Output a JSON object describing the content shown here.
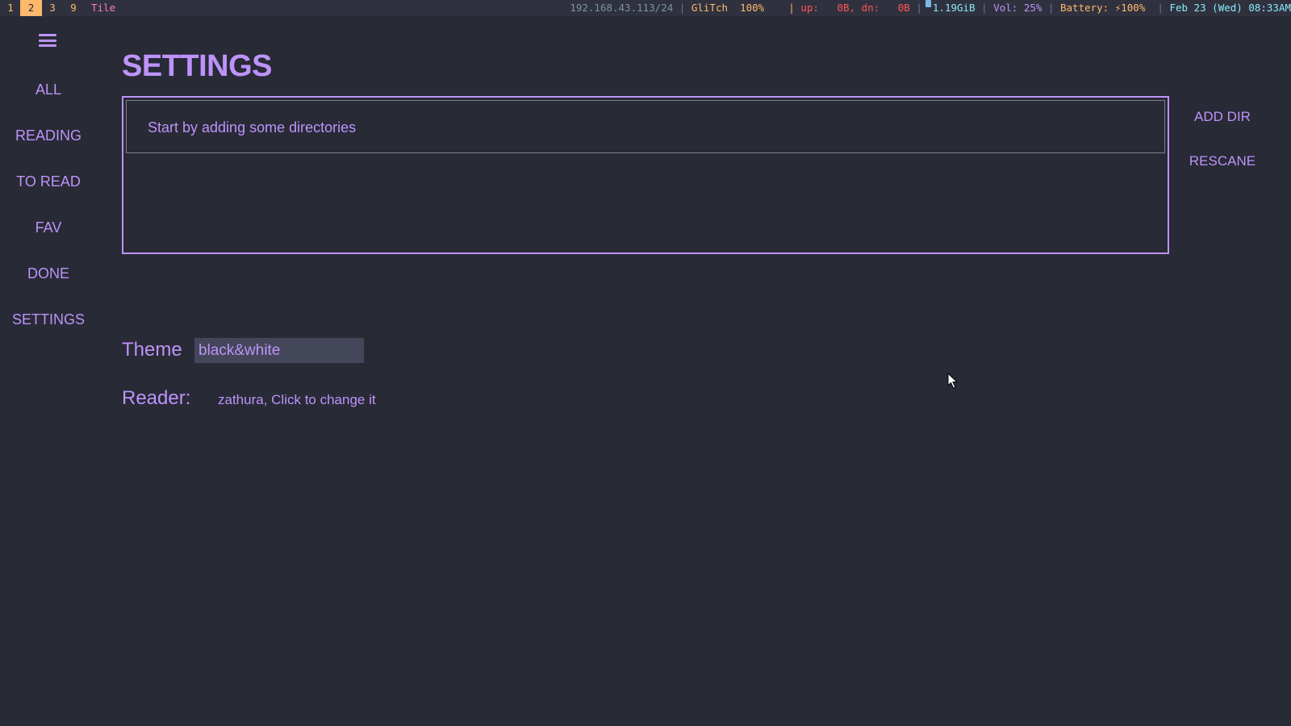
{
  "statusbar": {
    "workspaces": [
      {
        "label": "1",
        "active": false
      },
      {
        "label": "2",
        "active": true
      },
      {
        "label": "3",
        "active": false
      },
      {
        "label": "9",
        "active": false
      }
    ],
    "layout": "Tile",
    "network": "192.168.43.113/24",
    "wifi_name": "GliTch",
    "wifi_signal": "100%",
    "up_label": "up:",
    "up_value": "0B,",
    "down_label": "dn:",
    "down_value": "0B",
    "memory": "1.19GiB",
    "volume": "Vol: 25%",
    "battery": "Battery: ⚡100%",
    "datetime": "Feb 23 (Wed) 08:33AM",
    "separator": "|"
  },
  "sidebar": {
    "menu_icon": "hamburger-icon",
    "items": [
      {
        "label": "ALL"
      },
      {
        "label": "READING"
      },
      {
        "label": "TO READ"
      },
      {
        "label": "FAV"
      },
      {
        "label": "DONE"
      },
      {
        "label": "SETTINGS"
      }
    ]
  },
  "main": {
    "title": "SETTINGS",
    "directories": {
      "empty_text": "Start by adding some directories"
    },
    "add_dir_label": "ADD DIR",
    "rescan_label": "RESCANE",
    "theme": {
      "label": "Theme",
      "value": "black&white"
    },
    "reader": {
      "label": "Reader:",
      "value": "zathura, Click to change it"
    }
  },
  "colors": {
    "background": "#282a36",
    "accent": "#bd93f9",
    "bar_background": "#2f323e",
    "workspace_active": "#ffb86c"
  }
}
